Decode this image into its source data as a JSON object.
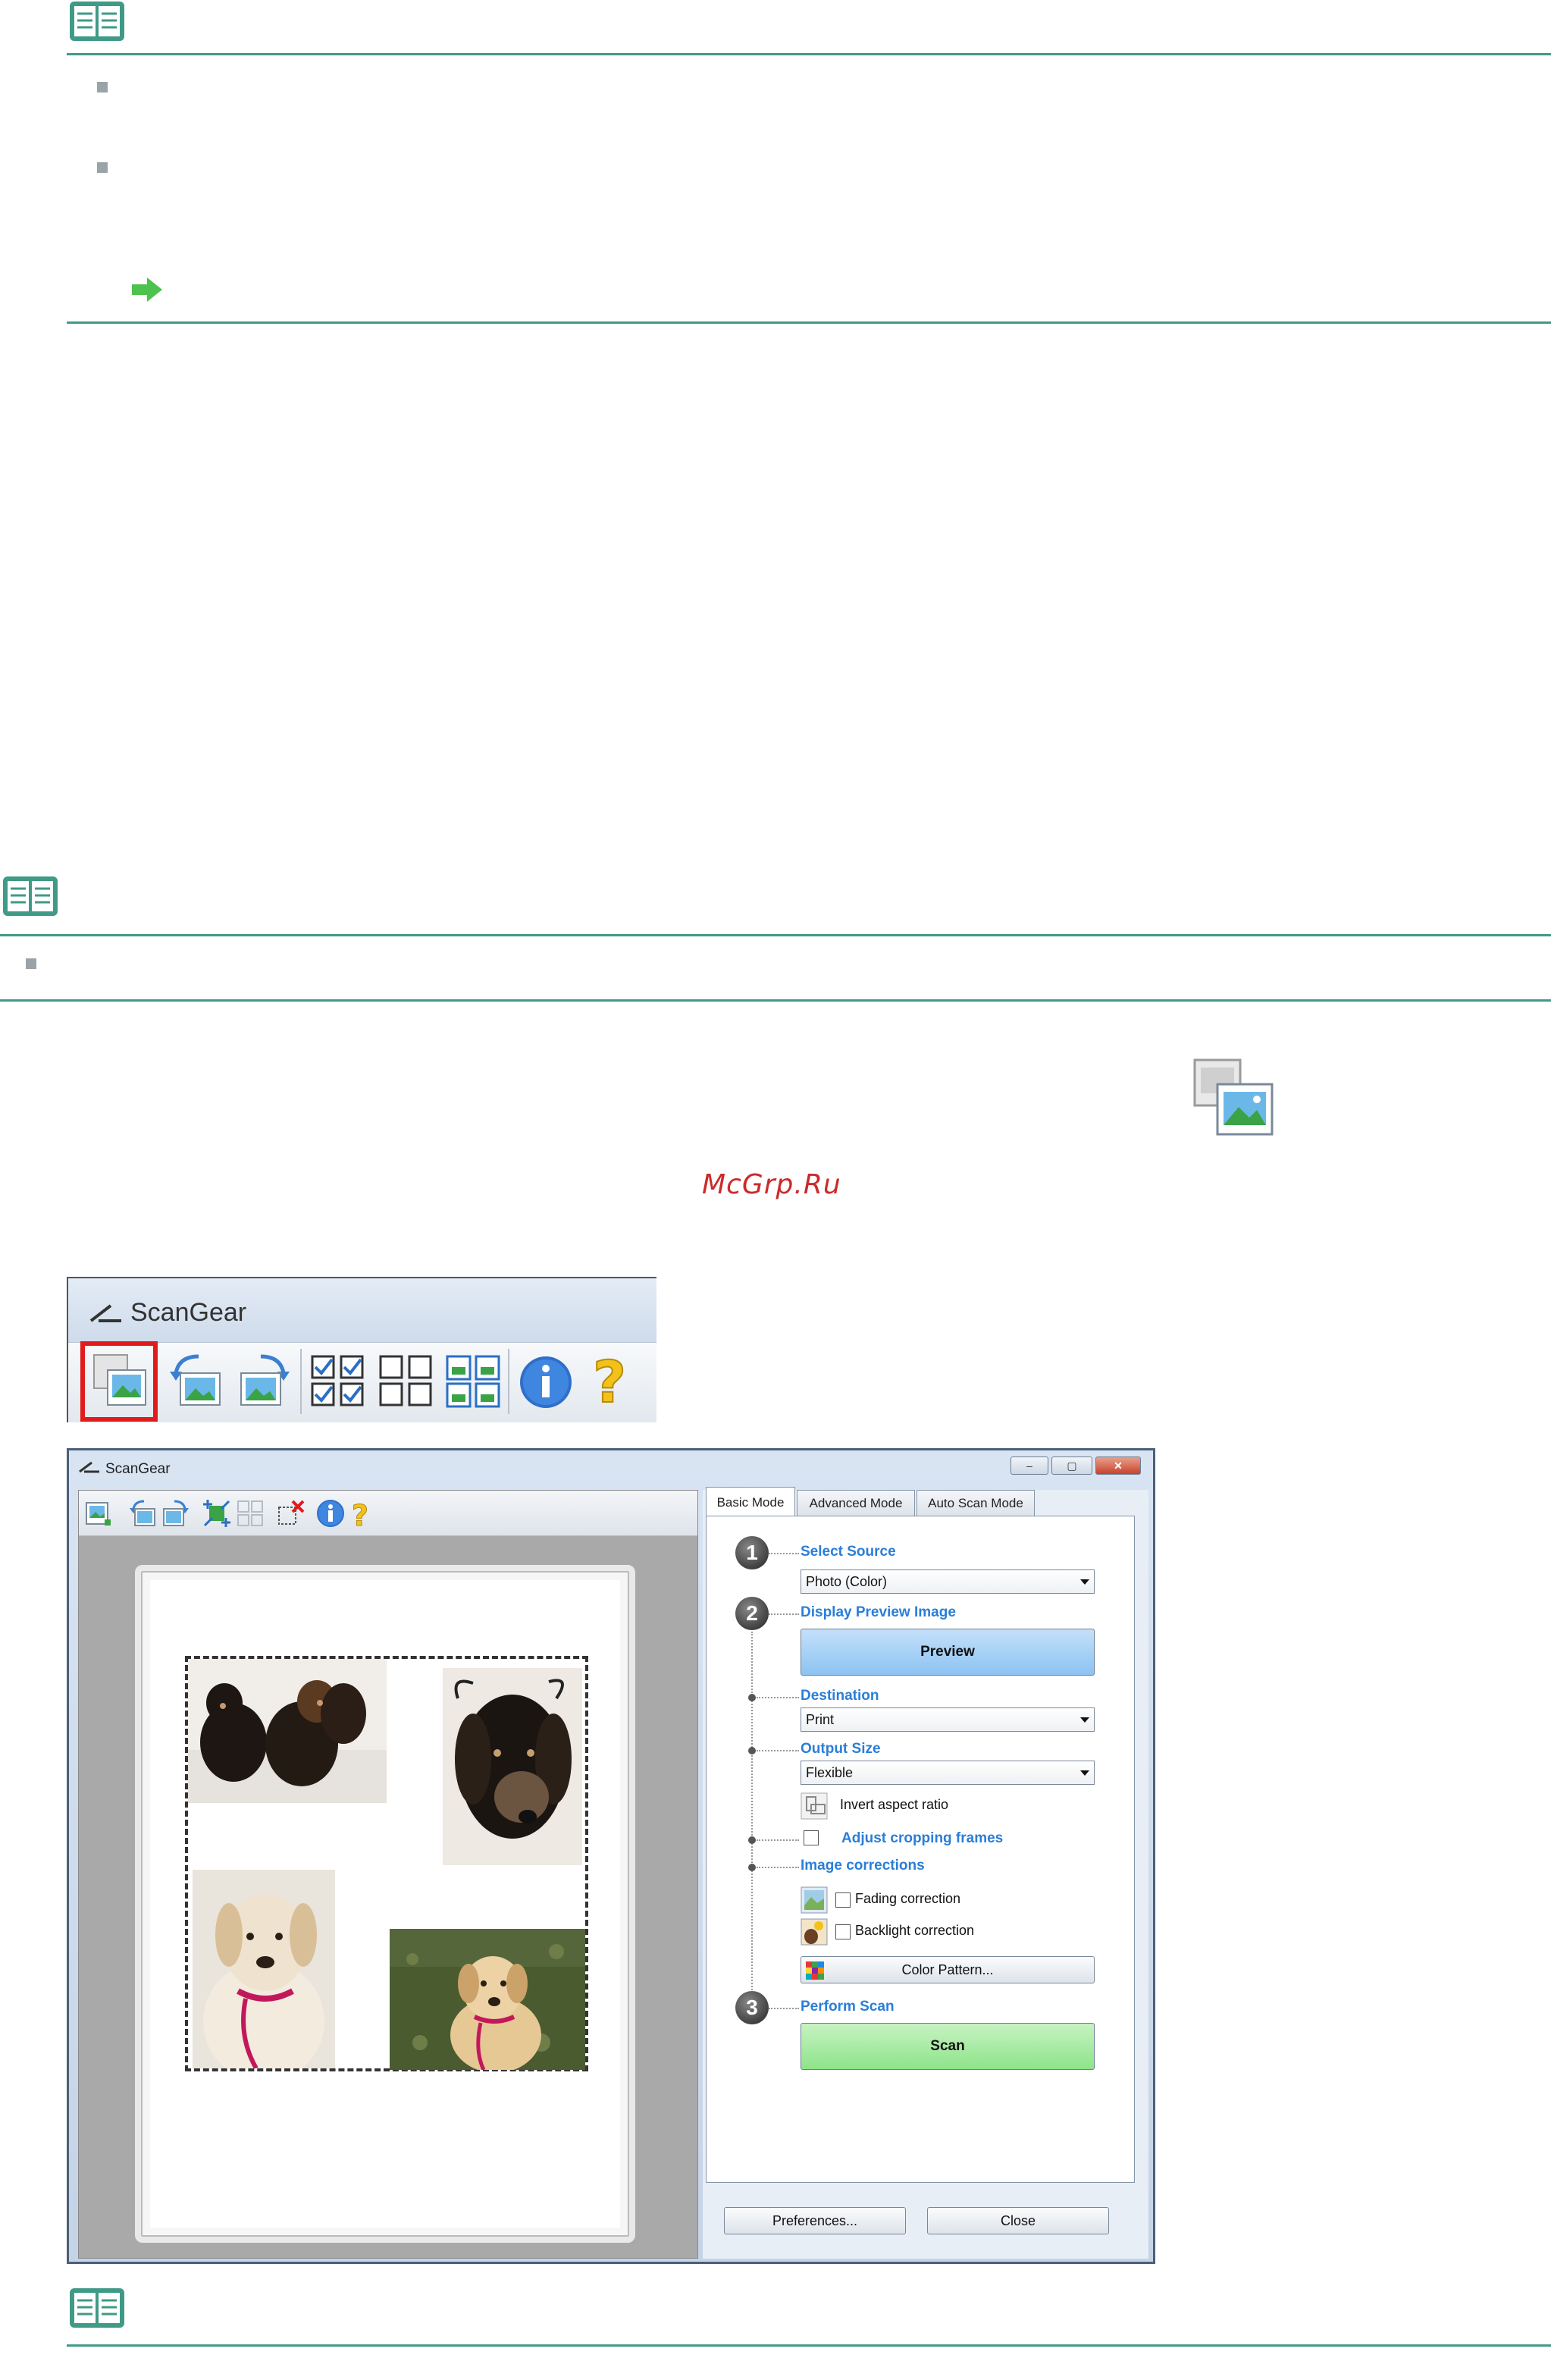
{
  "watermark": "McGrp.Ru",
  "toolbar_crop": {
    "title": "ScanGear"
  },
  "window": {
    "title": "ScanGear",
    "controls": {
      "minimize": "–",
      "maximize": "▢",
      "close": "✕"
    },
    "tabs": [
      "Basic Mode",
      "Advanced Mode",
      "Auto Scan Mode"
    ],
    "steps": [
      "1",
      "2",
      "3"
    ],
    "select_source": {
      "label": "Select Source",
      "value": "Photo (Color)"
    },
    "display_preview": {
      "label": "Display Preview Image",
      "button": "Preview"
    },
    "destination": {
      "label": "Destination",
      "value": "Print"
    },
    "output_size": {
      "label": "Output Size",
      "value": "Flexible",
      "invert": "Invert aspect ratio"
    },
    "adjust_cropping": "Adjust cropping frames",
    "image_corrections": {
      "label": "Image corrections",
      "fading": "Fading correction",
      "backlight": "Backlight correction",
      "color_pattern": "Color Pattern..."
    },
    "perform_scan": {
      "label": "Perform Scan",
      "button": "Scan"
    },
    "footer": {
      "preferences": "Preferences...",
      "close": "Close"
    }
  },
  "colors": {
    "rule": "#3f9a86",
    "step_label": "#2a7ed8",
    "preview_button": "#8cc3f2",
    "scan_button": "#8ee38a",
    "highlight": "#e11b1b",
    "watermark": "#cc2a2a"
  }
}
